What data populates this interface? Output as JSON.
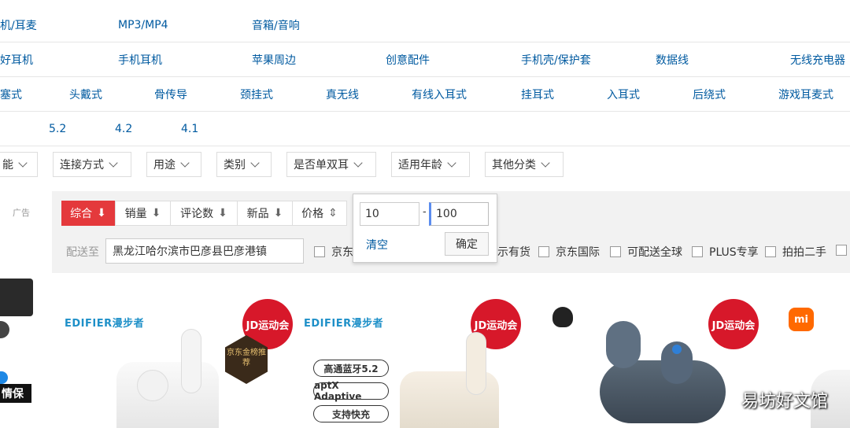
{
  "rows": {
    "row1": [
      "机/耳麦",
      "MP3/MP4",
      "音箱/音响"
    ],
    "row2": [
      "好耳机",
      "手机耳机",
      "苹果周边",
      "创意配件",
      "手机壳/保护套",
      "数据线",
      "无线充电器"
    ],
    "row3": [
      "塞式",
      "头戴式",
      "骨传导",
      "颈挂式",
      "真无线",
      "有线入耳式",
      "挂耳式",
      "入耳式",
      "后绕式",
      "游戏耳麦式"
    ],
    "row4": [
      "5.2",
      "4.2",
      "4.1"
    ]
  },
  "filters": [
    "能",
    "连接方式",
    "用途",
    "类别",
    "是否单双耳",
    "适用年龄",
    "其他分类"
  ],
  "ad_label": "广告",
  "sort": {
    "items": [
      {
        "label": "综合",
        "arrow": "⬇"
      },
      {
        "label": "销量",
        "arrow": "⬇"
      },
      {
        "label": "评论数",
        "arrow": "⬇"
      },
      {
        "label": "新品",
        "arrow": "⬇"
      },
      {
        "label": "价格",
        "arrow": "⇕"
      }
    ]
  },
  "price": {
    "min": "10",
    "dash": "-",
    "max": "100",
    "clear": "清空",
    "confirm": "确定"
  },
  "delivery": {
    "label": "配送至",
    "location": "黑龙江哈尔滨市巴彦县巴彦港镇",
    "options": [
      "京东",
      "示有货",
      "京东国际",
      "可配送全球",
      "PLUS专享",
      "拍拍二手"
    ]
  },
  "products": {
    "brand1": "EDIFIER漫步者",
    "brand2": "EDIFIER漫步者",
    "badge": "JD运动会",
    "gold": "京东金榜推荐",
    "pills": [
      "高通蓝牙5.2",
      "aptX Adaptive",
      "支持快充"
    ],
    "mi": "mi",
    "left_partial": "情保"
  },
  "watermark": "易坊好文馆",
  "colors": {
    "accent": "#e4393c",
    "link": "#005aa0"
  }
}
